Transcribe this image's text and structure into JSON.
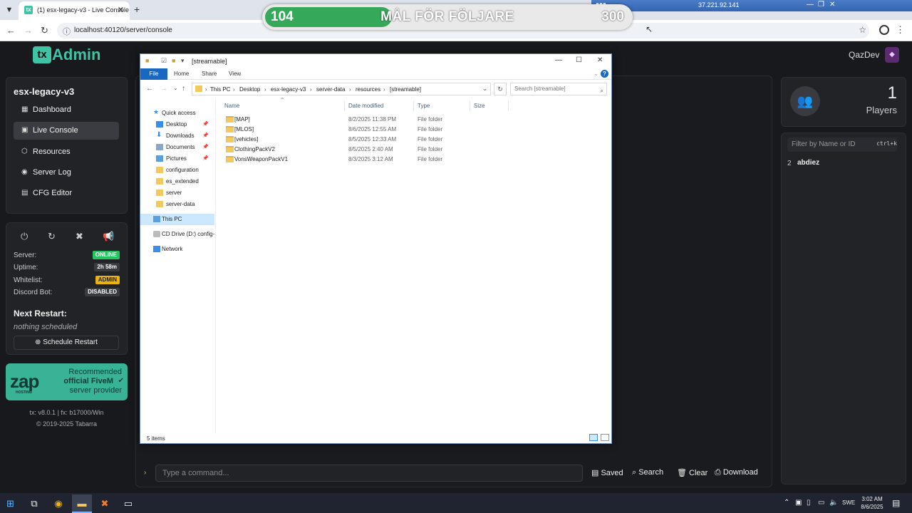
{
  "browser": {
    "tab_title": "(1) esx-legacy-v3 - Live Console",
    "url": "localhost:40120/server/console"
  },
  "overlay": {
    "goal_current": "104",
    "goal_label": "MÅL FÖR FÖLJARE",
    "goal_target": "300",
    "goal_progress": 0.347,
    "remote_ip": "37.221.92.141"
  },
  "txadmin": {
    "logo_text": "Admin",
    "user": "QazDev",
    "server_name": "esx-legacy-v3",
    "menu": [
      {
        "label": "Dashboard",
        "icon": "grid-icon"
      },
      {
        "label": "Live Console",
        "icon": "terminal-icon",
        "active": true
      },
      {
        "label": "Resources",
        "icon": "box-icon"
      },
      {
        "label": "Server Log",
        "icon": "eye-icon"
      },
      {
        "label": "CFG Editor",
        "icon": "file-edit-icon"
      }
    ],
    "status": {
      "server_label": "Server:",
      "server_value": "ONLINE",
      "server_color": "#22c55e",
      "uptime_label": "Uptime:",
      "uptime_value": "2h 58m",
      "whitelist_label": "Whitelist:",
      "whitelist_value": "ADMIN",
      "whitelist_color": "#eab308",
      "discord_label": "Discord Bot:",
      "discord_value": "DISABLED"
    },
    "next_restart": {
      "title": "Next Restart:",
      "value": "nothing scheduled",
      "button": "Schedule Restart"
    },
    "zap": {
      "logo": "zap",
      "sub": "HOSTING",
      "line1": "Recommended",
      "line2": "official FiveM",
      "line3": "server provider"
    },
    "version": "tx: v8.0.1 | fx: b17000/Win",
    "copyright": "© 2019-2025 Tabarra",
    "console": {
      "placeholder": "Type a command...",
      "saved": "Saved",
      "search": "Search",
      "clear": "Clear",
      "download": "Download"
    },
    "players": {
      "count": "1",
      "label": "Players",
      "filter_placeholder": "Filter by Name or ID",
      "filter_kbd": "ctrl+k",
      "list": [
        {
          "id": "2",
          "name": "abdiez"
        }
      ]
    }
  },
  "explorer": {
    "title": "[streamable]",
    "ribbon": {
      "file": "File",
      "home": "Home",
      "share": "Share",
      "view": "View"
    },
    "breadcrumbs": [
      "This PC",
      "Desktop",
      "esx-legacy-v3",
      "server-data",
      "resources",
      "[streamable]"
    ],
    "search_placeholder": "Search [streamable]",
    "nav": [
      {
        "label": "Quick access",
        "icon": "star-icon"
      },
      {
        "label": "Desktop",
        "icon": "desktop-icon",
        "pinned": true
      },
      {
        "label": "Downloads",
        "icon": "download-icon",
        "pinned": true
      },
      {
        "label": "Documents",
        "icon": "documents-icon",
        "pinned": true
      },
      {
        "label": "Pictures",
        "icon": "pictures-icon",
        "pinned": true
      },
      {
        "label": "configuration",
        "icon": "folder-icon"
      },
      {
        "label": "es_extended",
        "icon": "folder-icon"
      },
      {
        "label": "server",
        "icon": "folder-icon"
      },
      {
        "label": "server-data",
        "icon": "folder-icon"
      },
      {
        "label": "This PC",
        "icon": "pc-icon",
        "selected": true
      },
      {
        "label": "CD Drive (D:) config-",
        "icon": "cd-drive-icon"
      },
      {
        "label": "Network",
        "icon": "network-icon"
      }
    ],
    "columns": {
      "name": "Name",
      "date": "Date modified",
      "type": "Type",
      "size": "Size"
    },
    "files": [
      {
        "name": "[MAP]",
        "date": "8/2/2025 11:38 PM",
        "type": "File folder"
      },
      {
        "name": "[MLOS]",
        "date": "8/6/2025 12:55 AM",
        "type": "File folder"
      },
      {
        "name": "[vehicles]",
        "date": "8/5/2025 12:33 AM",
        "type": "File folder"
      },
      {
        "name": "ClothingPackV2",
        "date": "8/5/2025 2:40 AM",
        "type": "File folder"
      },
      {
        "name": "VonsWeaponPackV1",
        "date": "8/3/2025 3:12 AM",
        "type": "File folder"
      }
    ],
    "status": "5 items"
  },
  "taskbar": {
    "lang": "SWE",
    "time": "3:02 AM",
    "date": "8/6/2025"
  }
}
